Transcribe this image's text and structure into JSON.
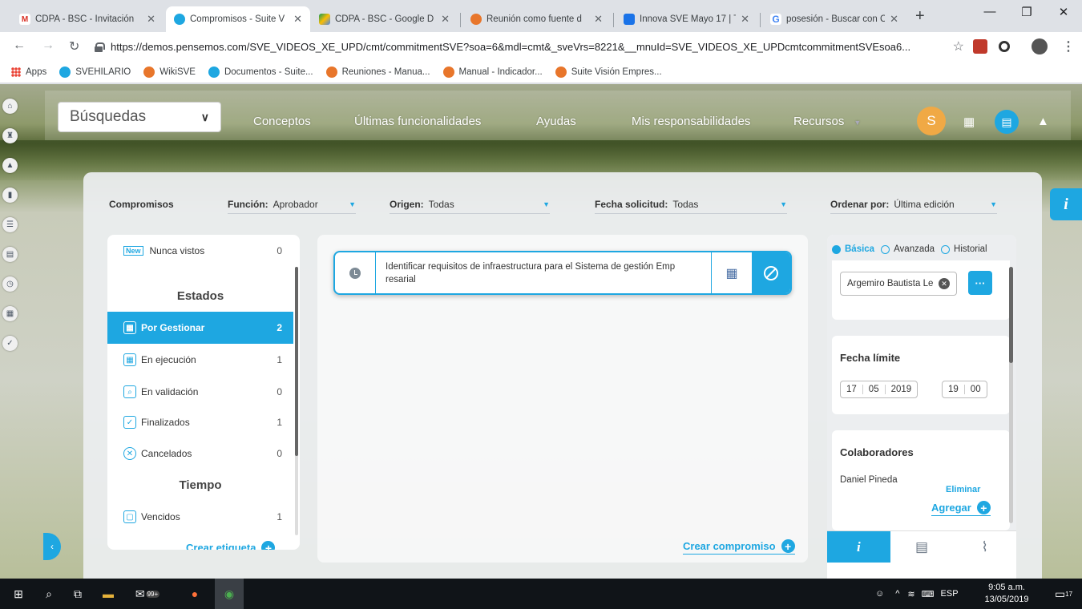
{
  "browser": {
    "tabs": [
      {
        "title": "CDPA - BSC - Invitación",
        "icon": "gmail-icon",
        "color": "#d93025",
        "active": false
      },
      {
        "title": "Compromisos - Suite V",
        "icon": "sve-icon",
        "color": "#1ea7e1",
        "active": true
      },
      {
        "title": "CDPA - BSC - Google D",
        "icon": "drive-icon",
        "color": "#fbbc04",
        "active": false
      },
      {
        "title": "Reunión como fuente d",
        "icon": "wiki-icon",
        "color": "#e8762b",
        "active": false
      },
      {
        "title": "Innova SVE Mayo 17 | T",
        "icon": "doc-icon",
        "color": "#1a73e8",
        "active": false
      },
      {
        "title": "posesión - Buscar con C",
        "icon": "google-icon",
        "color": "#4285f4",
        "active": false
      }
    ],
    "url": "https://demos.pensemos.com/SVE_VIDEOS_XE_UPD/cmt/commitmentSVE?soa=6&mdl=cmt&_sveVrs=8221&__mnuId=SVE_VIDEOS_XE_UPDcmtcommitmentSVEsoa6...",
    "bookmarks": [
      {
        "label": "Apps",
        "icon": "apps-icon"
      },
      {
        "label": "SVEHILARIO",
        "icon": "sve-icon"
      },
      {
        "label": "WikiSVE",
        "icon": "wiki-icon"
      },
      {
        "label": "Documentos - Suite...",
        "icon": "sve-icon"
      },
      {
        "label": "Reuniones - Manua...",
        "icon": "wiki-icon"
      },
      {
        "label": "Manual - Indicador...",
        "icon": "wiki-icon"
      },
      {
        "label": "Suite Visión Empres...",
        "icon": "wiki-icon"
      }
    ]
  },
  "header": {
    "search_label": "Búsquedas",
    "nav": [
      "Conceptos",
      "Últimas funcionalidades",
      "Ayudas",
      "Mis responsabilidades",
      "Recursos"
    ],
    "avatar_letter": "S"
  },
  "filters": {
    "title": "Compromisos",
    "funcion_label": "Función:",
    "funcion_value": "Aprobador",
    "origen_label": "Origen:",
    "origen_value": "Todas",
    "fecha_label": "Fecha solicitud:",
    "fecha_value": "Todas",
    "ordenar_label": "Ordenar por:",
    "ordenar_value": "Última edición"
  },
  "states": {
    "new_badge": "New",
    "nunca_vistos": {
      "label": "Nunca vistos",
      "count": "0"
    },
    "estados_heading": "Estados",
    "items": [
      {
        "label": "Por Gestionar",
        "count": "2",
        "icon": "calendar-icon",
        "selected": true
      },
      {
        "label": "En ejecución",
        "count": "1",
        "icon": "calendar-grid-icon",
        "selected": false
      },
      {
        "label": "En validación",
        "count": "0",
        "icon": "search-doc-icon",
        "selected": false
      },
      {
        "label": "Finalizados",
        "count": "1",
        "icon": "check-icon",
        "selected": false
      },
      {
        "label": "Cancelados",
        "count": "0",
        "icon": "x-circle-icon",
        "selected": false
      }
    ],
    "tiempo_heading": "Tiempo",
    "vencidos": {
      "label": "Vencidos",
      "count": "1"
    },
    "crear_etiqueta": "Crear etiqueta"
  },
  "commitment": {
    "text": "Identificar requisitos de infraestructura para el Sistema de gestión Emp resarial",
    "crear_compromiso": "Crear compromiso"
  },
  "detail": {
    "radio_basica": "Básica",
    "radio_avanzada": "Avanzada",
    "radio_historial": "Historial",
    "responsable": "Argemiro Bautista Le",
    "more_label": "···",
    "fecha_limite_title": "Fecha límite",
    "fecha": {
      "day": "17",
      "month": "05",
      "year": "2019",
      "hour": "19",
      "minute": "00"
    },
    "colaboradores_title": "Colaboradores",
    "colaborador": "Daniel Pineda",
    "eliminar": "Eliminar",
    "agregar": "Agregar"
  },
  "taskbar": {
    "badge_count": "99+",
    "language": "ESP",
    "time": "9:05 a.m.",
    "date": "13/05/2019",
    "notifications": "17"
  },
  "colors": {
    "accent": "#1ea7e1",
    "avatar": "#f0a945"
  }
}
